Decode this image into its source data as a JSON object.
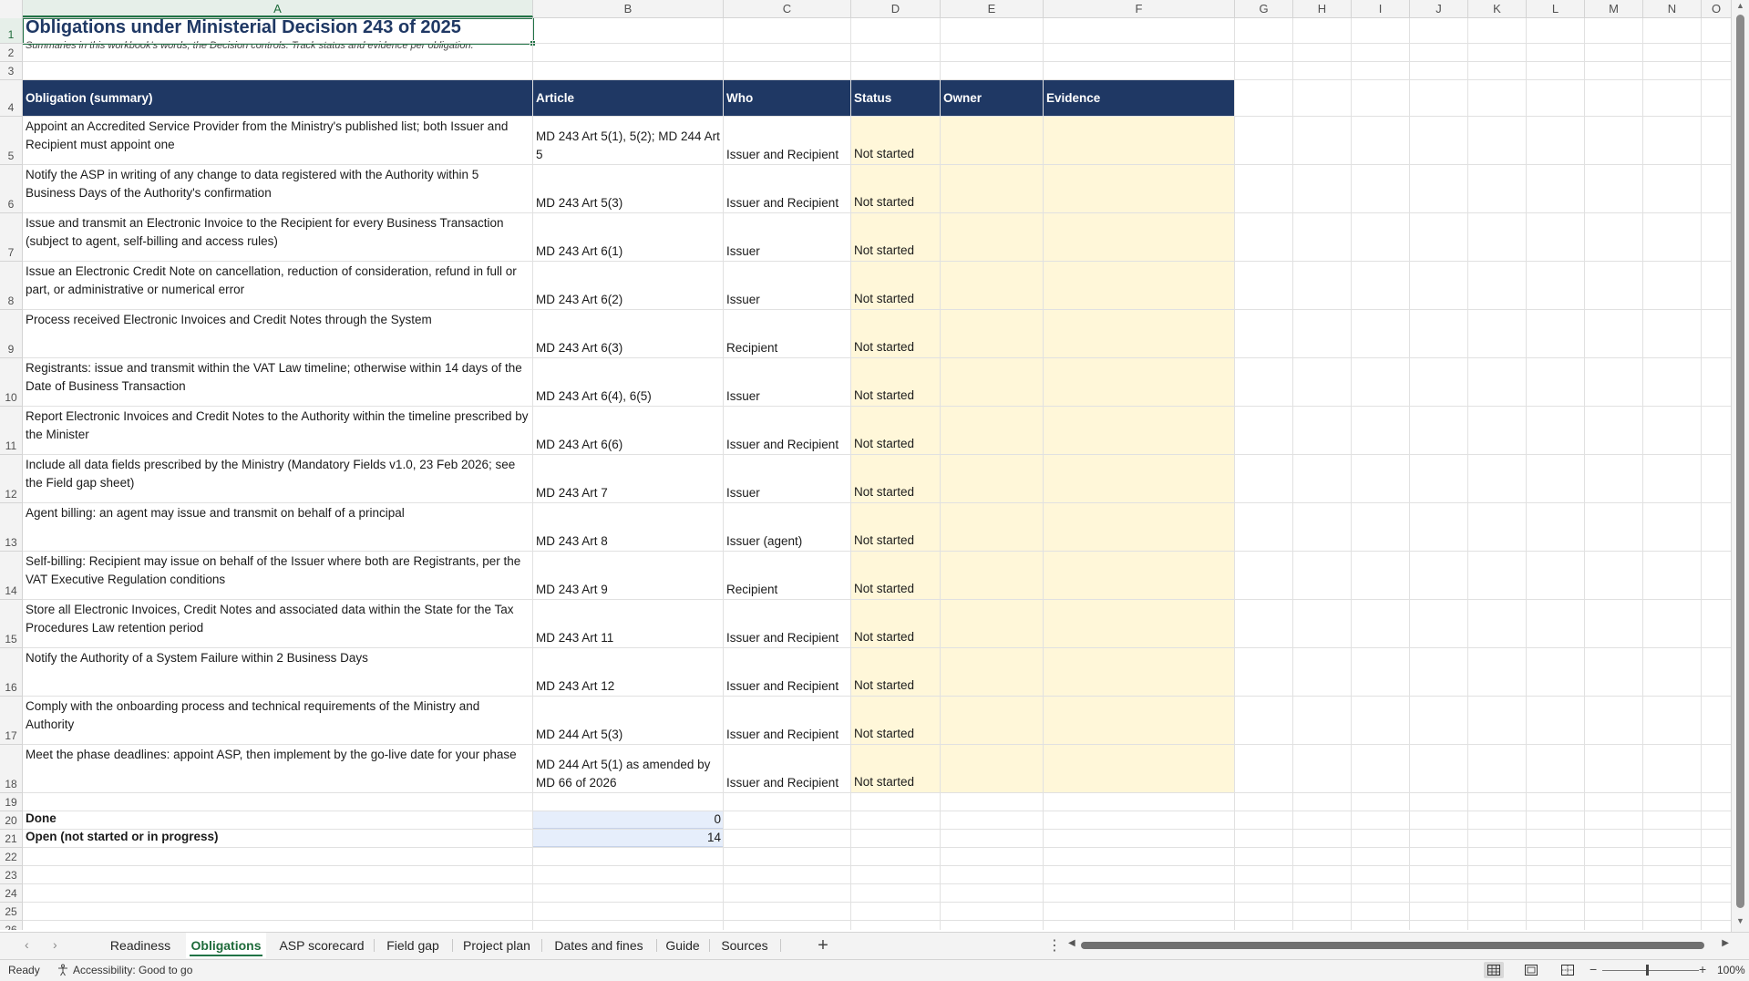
{
  "columns": [
    "A",
    "B",
    "C",
    "D",
    "E",
    "F",
    "G",
    "H",
    "I",
    "J",
    "K",
    "L",
    "M",
    "N",
    "O"
  ],
  "title": "Obligations under Ministerial Decision 243 of 2025",
  "subtitle": "Summaries in this workbook's words; the Decision controls. Track status and evidence per obligation.",
  "headers": {
    "obligation": "Obligation (summary)",
    "article": "Article",
    "who": "Who",
    "status": "Status",
    "owner": "Owner",
    "evidence": "Evidence"
  },
  "rows": [
    {
      "row": "5",
      "obligation": "Appoint an Accredited Service Provider from the Ministry's published list; both Issuer and Recipient must appoint one",
      "article": "MD 243 Art 5(1), 5(2); MD 244 Art 5",
      "who": "Issuer and Recipient",
      "status": "Not started"
    },
    {
      "row": "6",
      "obligation": "Notify the ASP in writing of any change to data registered with the Authority within 5 Business Days of the Authority's confirmation",
      "article": "MD 243 Art 5(3)",
      "who": "Issuer and Recipient",
      "status": "Not started"
    },
    {
      "row": "7",
      "obligation": "Issue and transmit an Electronic Invoice to the Recipient for every Business Transaction (subject to agent, self-billing and access rules)",
      "article": "MD 243 Art 6(1)",
      "who": "Issuer",
      "status": "Not started"
    },
    {
      "row": "8",
      "obligation": "Issue an Electronic Credit Note on cancellation, reduction of consideration, refund in full or part, or administrative or numerical error",
      "article": "MD 243 Art 6(2)",
      "who": "Issuer",
      "status": "Not started"
    },
    {
      "row": "9",
      "obligation": "Process received Electronic Invoices and Credit Notes through the System",
      "article": "MD 243 Art 6(3)",
      "who": "Recipient",
      "status": "Not started"
    },
    {
      "row": "10",
      "obligation": "Registrants: issue and transmit within the VAT Law timeline; otherwise within 14 days of the Date of Business Transaction",
      "article": "MD 243 Art 6(4), 6(5)",
      "who": "Issuer",
      "status": "Not started"
    },
    {
      "row": "11",
      "obligation": "Report Electronic Invoices and Credit Notes to the Authority within the timeline prescribed by the Minister",
      "article": "MD 243 Art 6(6)",
      "who": "Issuer and Recipient",
      "status": "Not started"
    },
    {
      "row": "12",
      "obligation": "Include all data fields prescribed by the Ministry (Mandatory Fields v1.0, 23 Feb 2026; see the Field gap sheet)",
      "article": "MD 243 Art 7",
      "who": "Issuer",
      "status": "Not started"
    },
    {
      "row": "13",
      "obligation": "Agent billing: an agent may issue and transmit on behalf of a principal",
      "article": "MD 243 Art 8",
      "who": "Issuer (agent)",
      "status": "Not started"
    },
    {
      "row": "14",
      "obligation": "Self-billing: Recipient may issue on behalf of the Issuer where both are Registrants, per the VAT Executive Regulation conditions",
      "article": "MD 243 Art 9",
      "who": "Recipient",
      "status": "Not started"
    },
    {
      "row": "15",
      "obligation": "Store all Electronic Invoices, Credit Notes and associated data within the State for the Tax Procedures Law retention period",
      "article": "MD 243 Art 11",
      "who": "Issuer and Recipient",
      "status": "Not started"
    },
    {
      "row": "16",
      "obligation": "Notify the Authority of a System Failure within 2 Business Days",
      "article": "MD 243 Art 12",
      "who": "Issuer and Recipient",
      "status": "Not started"
    },
    {
      "row": "17",
      "obligation": "Comply with the onboarding process and technical requirements of the Ministry and Authority",
      "article": "MD 244 Art 5(3)",
      "who": "Issuer and Recipient",
      "status": "Not started"
    },
    {
      "row": "18",
      "obligation": "Meet the phase deadlines: appoint ASP, then implement by the go-live date for your phase",
      "article": "MD 244 Art 5(1) as amended by MD 66 of 2026",
      "who": "Issuer and Recipient",
      "status": "Not started"
    }
  ],
  "summary": {
    "done_label": "Done",
    "done_value": "0",
    "open_label": "Open (not started or in progress)",
    "open_value": "14"
  },
  "tabs": [
    "Readiness",
    "Obligations",
    "ASP scorecard",
    "Field gap",
    "Project plan",
    "Dates and fines",
    "Guide",
    "Sources"
  ],
  "active_tab": "Obligations",
  "status_bar": {
    "ready": "Ready",
    "accessibility": "Accessibility: Good to go",
    "zoom": "100%"
  },
  "colors": {
    "header_fill": "#1f3864",
    "input_fill": "#fff7d9",
    "total_fill": "#e6eefb",
    "accent": "#217346"
  }
}
